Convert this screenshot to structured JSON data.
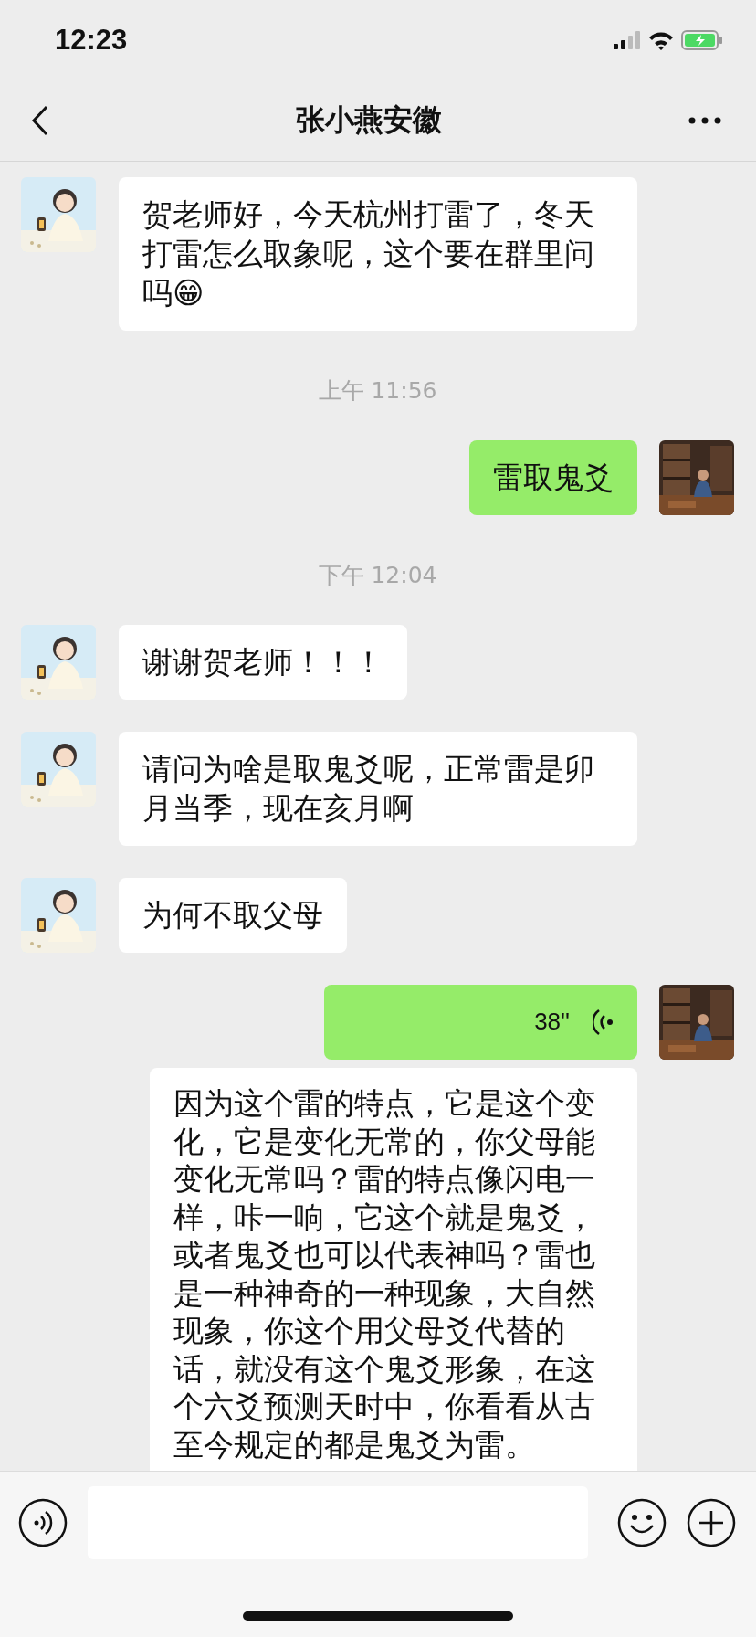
{
  "status_bar": {
    "time": "12:23"
  },
  "header": {
    "title": "张小燕安徽"
  },
  "messages": [
    {
      "kind": "text",
      "outgoing": false,
      "text": "贺老师好，今天杭州打雷了，冬天打雷怎么取象呢，这个要在群里问吗😁"
    },
    {
      "kind": "time",
      "text": "上午 11:56"
    },
    {
      "kind": "text",
      "outgoing": true,
      "text": "雷取鬼爻"
    },
    {
      "kind": "time",
      "text": "下午 12:04"
    },
    {
      "kind": "text",
      "outgoing": false,
      "text": "谢谢贺老师！！！"
    },
    {
      "kind": "text",
      "outgoing": false,
      "text": "请问为啥是取鬼爻呢，正常雷是卯月当季，现在亥月啊"
    },
    {
      "kind": "text",
      "outgoing": false,
      "text": "为何不取父母"
    },
    {
      "kind": "voice",
      "outgoing": true,
      "duration": "38''",
      "transcript": "因为这个雷的特点，它是这个变化，它是变化无常的，你父母能变化无常吗？雷的特点像闪电一样，咔一响，它这个就是鬼爻，或者鬼爻也可以代表神吗？雷也是一种神奇的一种现象，大自然现象，你这个用父母爻代替的话，就没有这个鬼爻形象，在这个六爻预测天时中，你看看从古至今规定的都是鬼爻为雷。"
    }
  ]
}
